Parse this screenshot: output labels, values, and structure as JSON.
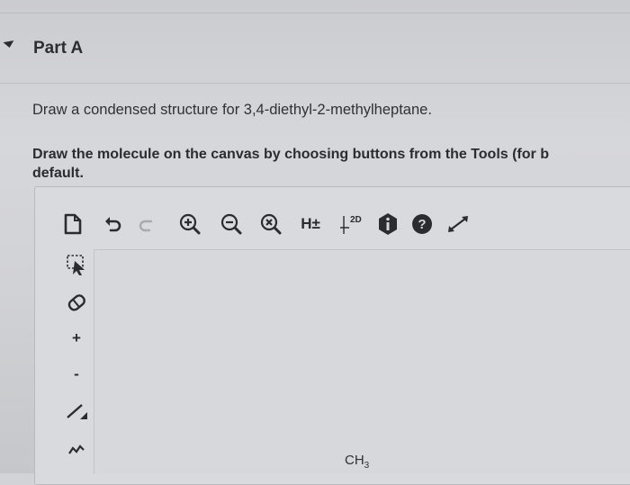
{
  "part": {
    "title": "Part A"
  },
  "question": {
    "prompt": "Draw a condensed structure for 3,4-diethyl-2-methylheptane.",
    "instruction_line1": "Draw the molecule on the canvas by choosing buttons from the Tools (for b",
    "instruction_line2": "default."
  },
  "toolbar": {
    "icons": [
      "new-document-icon",
      "undo-icon",
      "redo-icon",
      "zoom-in-icon",
      "zoom-out-icon",
      "reset-zoom-icon",
      "explicit-hydrogens-icon",
      "clean-2d-icon",
      "info-icon",
      "help-icon",
      "fullscreen-icon"
    ],
    "hydrogens_label": "H±",
    "clean_label": "2D"
  },
  "left_tools": {
    "icons": [
      "selection-tool-icon",
      "eraser-icon",
      "plus-charge-icon",
      "minus-charge-icon",
      "single-bond-icon",
      "chain-tool-icon"
    ],
    "plus_label": "+",
    "minus_label": "-"
  },
  "canvas": {
    "atom_label": "CH",
    "atom_subscript": "3"
  },
  "colors": {
    "background": "#d2d3d6",
    "text": "#2d2f33"
  }
}
